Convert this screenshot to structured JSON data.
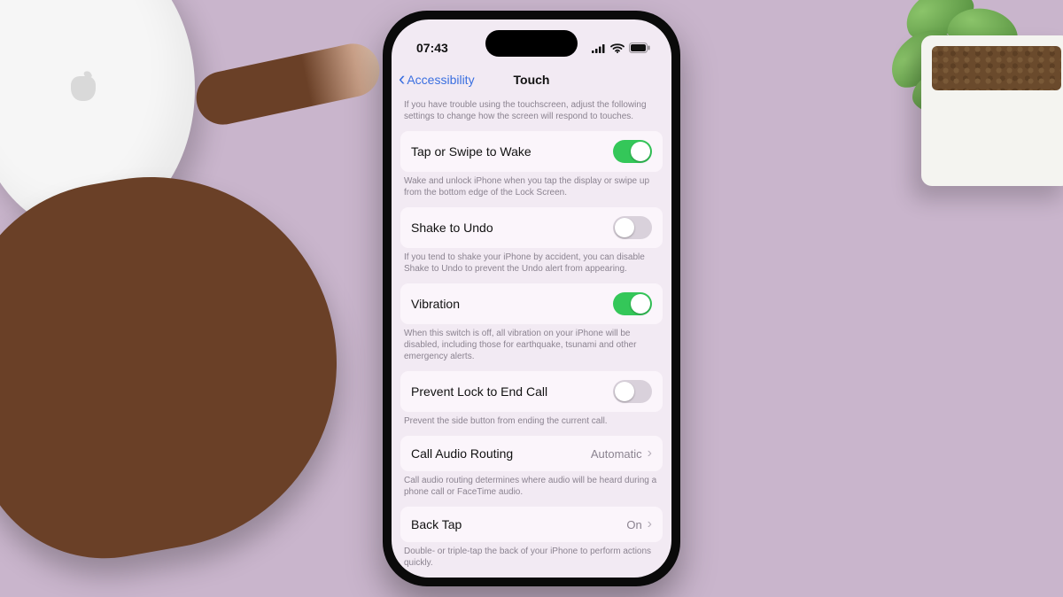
{
  "status": {
    "time": "07:43"
  },
  "nav": {
    "back": "Accessibility",
    "title": "Touch"
  },
  "intro_footer": "If you have trouble using the touchscreen, adjust the following settings to change how the screen will respond to touches.",
  "rows": {
    "tap_wake": {
      "label": "Tap or Swipe to Wake",
      "on": true,
      "footer": "Wake and unlock iPhone when you tap the display or swipe up from the bottom edge of the Lock Screen."
    },
    "shake_undo": {
      "label": "Shake to Undo",
      "on": false,
      "footer": "If you tend to shake your iPhone by accident, you can disable Shake to Undo to prevent the Undo alert from appearing."
    },
    "vibration": {
      "label": "Vibration",
      "on": true,
      "footer": "When this switch is off, all vibration on your iPhone will be disabled, including those for earthquake, tsunami and other emergency alerts."
    },
    "prevent_lock": {
      "label": "Prevent Lock to End Call",
      "on": false,
      "footer": "Prevent the side button from ending the current call."
    },
    "call_audio": {
      "label": "Call Audio Routing",
      "value": "Automatic",
      "footer": "Call audio routing determines where audio will be heard during a phone call or FaceTime audio."
    },
    "back_tap": {
      "label": "Back Tap",
      "value": "On",
      "footer": "Double- or triple-tap the back of your iPhone to perform actions quickly."
    }
  }
}
